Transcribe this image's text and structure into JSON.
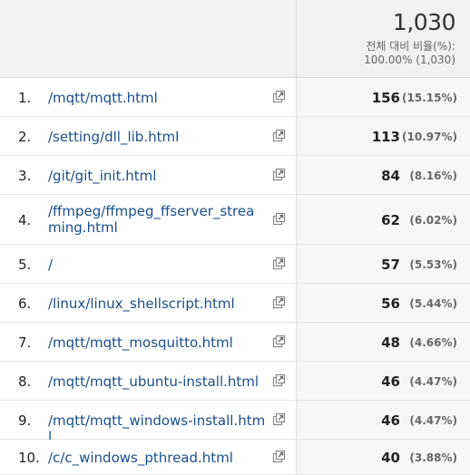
{
  "summary": {
    "total": "1,030",
    "caption": "전체 대비 비율(%):",
    "sub": "100.00% (1,030)"
  },
  "rows": [
    {
      "num": "1.",
      "page": "/mqtt/mqtt.html",
      "count": "156",
      "pct": "(15.15%)"
    },
    {
      "num": "2.",
      "page": "/setting/dll_lib.html",
      "count": "113",
      "pct": "(10.97%)"
    },
    {
      "num": "3.",
      "page": "/git/git_init.html",
      "count": "84",
      "pct": "(8.16%)"
    },
    {
      "num": "4.",
      "page": "/ffmpeg/ffmpeg_ffserver_streaming.html",
      "count": "62",
      "pct": "(6.02%)"
    },
    {
      "num": "5.",
      "page": "/",
      "count": "57",
      "pct": "(5.53%)"
    },
    {
      "num": "6.",
      "page": "/linux/linux_shellscript.html",
      "count": "56",
      "pct": "(5.44%)"
    },
    {
      "num": "7.",
      "page": "/mqtt/mqtt_mosquitto.html",
      "count": "48",
      "pct": "(4.66%)"
    },
    {
      "num": "8.",
      "page": "/mqtt/mqtt_ubuntu-install.html",
      "count": "46",
      "pct": "(4.47%)"
    },
    {
      "num": "9.",
      "page": "/mqtt/mqtt_windows-install.html",
      "count": "46",
      "pct": "(4.47%)"
    },
    {
      "num": "10.",
      "page": "/c/c_windows_pthread.html",
      "count": "40",
      "pct": "(3.88%)"
    }
  ],
  "icons": {
    "open_external": "open-in-new-window-icon"
  },
  "colors": {
    "link": "#1a4f8a",
    "header_bg": "#f1f1f1",
    "metric_bg": "#f7f7f7"
  }
}
